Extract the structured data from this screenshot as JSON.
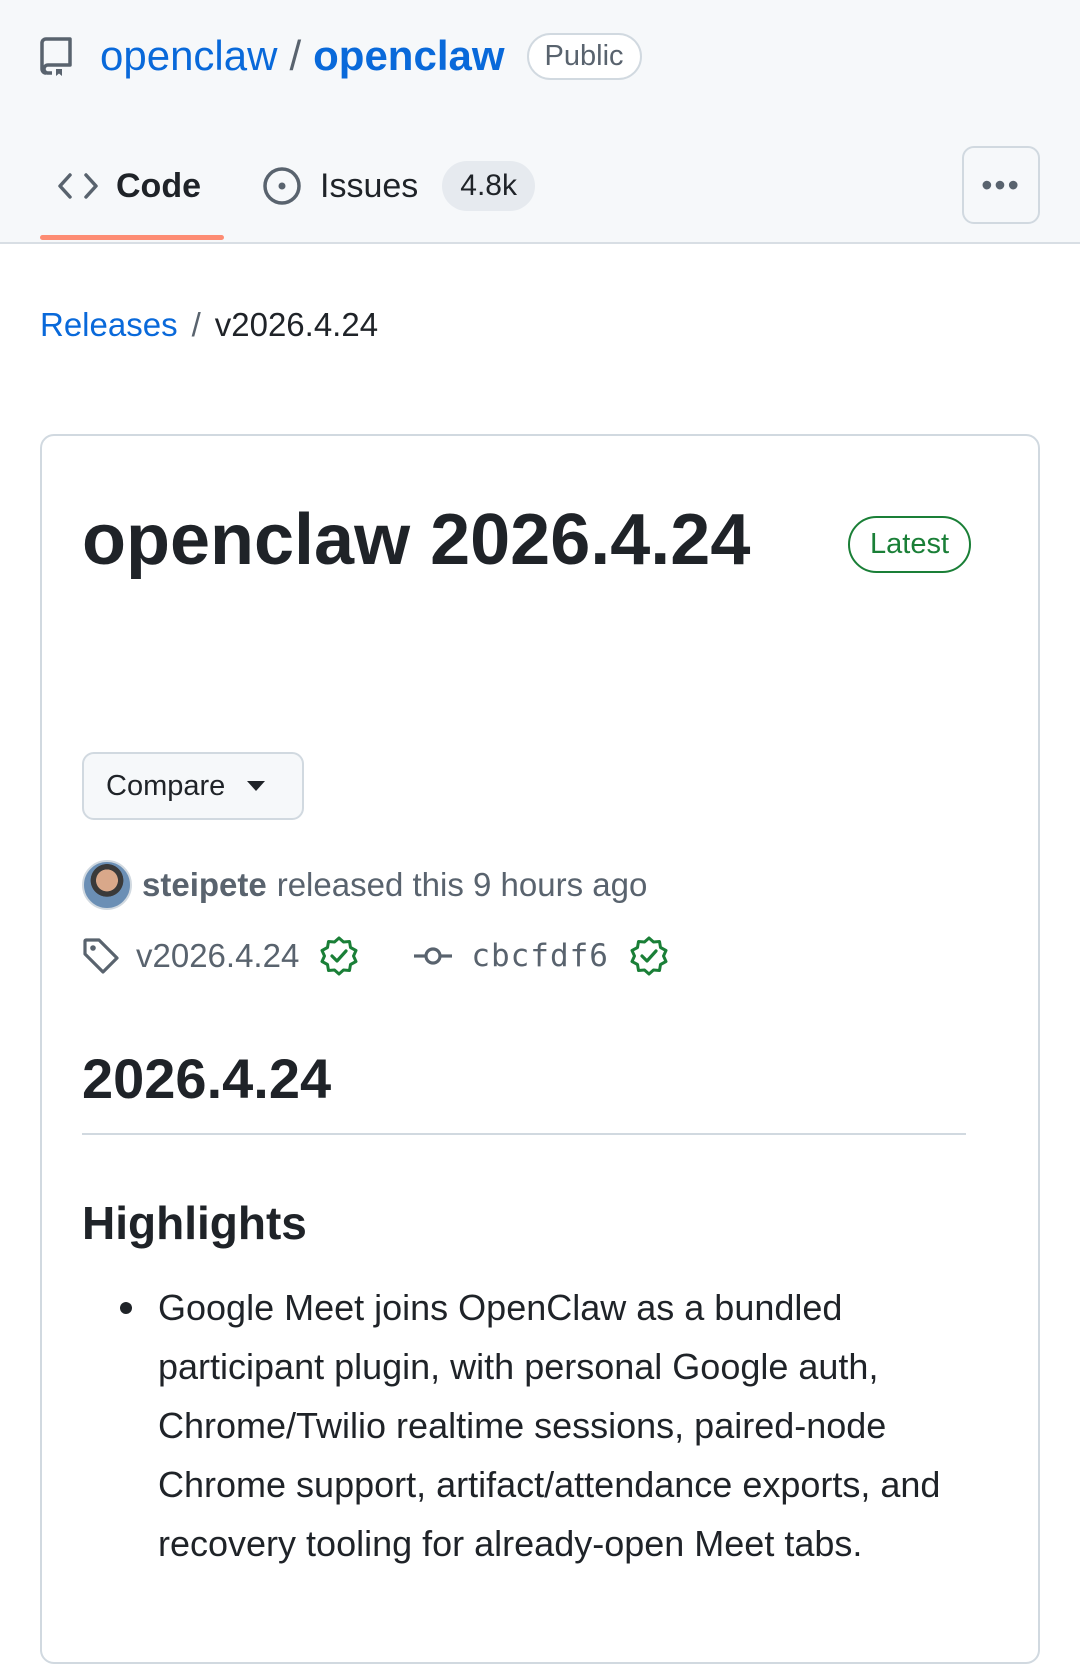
{
  "repo": {
    "owner": "openclaw",
    "separator": "/",
    "name": "openclaw",
    "visibility": "Public",
    "icon": "repo-icon"
  },
  "tabs": [
    {
      "label": "Code",
      "icon": "code-icon",
      "selected": true
    },
    {
      "label": "Issues",
      "icon": "issue-opened-icon",
      "counter": "4.8k"
    }
  ],
  "more_menu": {
    "label": "•••",
    "icon": "kebab-horizontal-icon"
  },
  "breadcrumb": {
    "parent": "Releases",
    "separator": "/",
    "current": "v2026.4.24"
  },
  "release": {
    "title": "openclaw 2026.4.24",
    "badge": "Latest",
    "compare_label": "Compare",
    "author": "steipete",
    "released_text": "released this 9 hours ago",
    "tag": "v2026.4.24",
    "commit": "cbcfdf6",
    "body_heading": "2026.4.24",
    "section_heading": "Highlights",
    "highlights": [
      "Google Meet joins OpenClaw as a bundled participant plugin, with personal Google auth, Chrome/Twilio realtime sessions, paired-node Chrome support, artifact/attendance exports, and recovery tooling for already-open Meet tabs."
    ]
  },
  "colors": {
    "link": "#0969da",
    "selected_tab_underline": "#fd8c73",
    "verified_green": "#1a7f37",
    "header_bg": "#f6f8fa"
  }
}
